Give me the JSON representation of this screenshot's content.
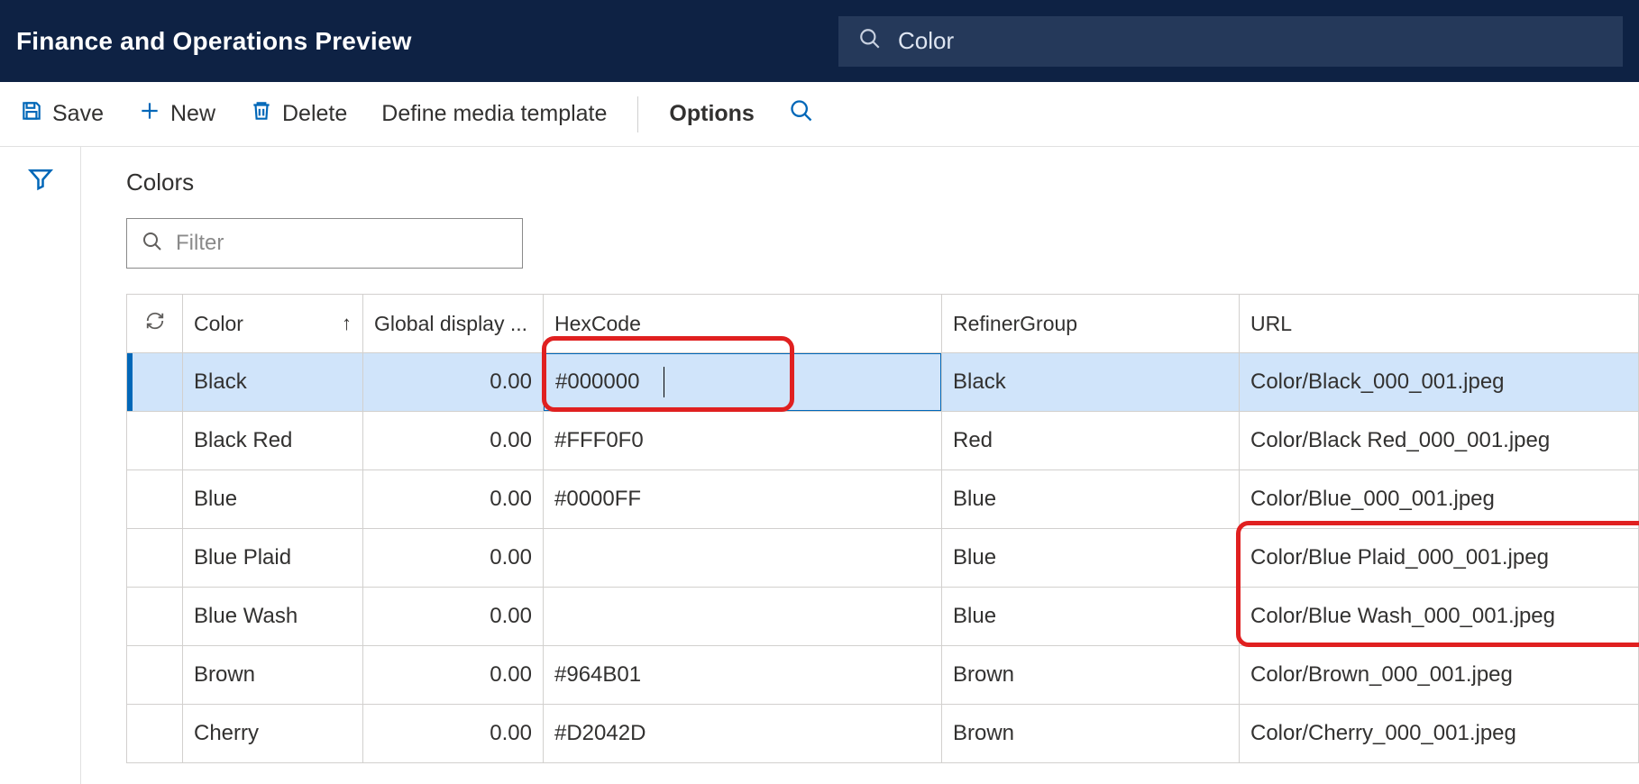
{
  "header": {
    "title": "Finance and Operations Preview",
    "search_value": "Color"
  },
  "toolbar": {
    "save": "Save",
    "new": "New",
    "delete": "Delete",
    "define_media": "Define media template",
    "options": "Options"
  },
  "page": {
    "title": "Colors",
    "filter_placeholder": "Filter"
  },
  "grid": {
    "headers": {
      "color": "Color",
      "global": "Global display ...",
      "hex": "HexCode",
      "refiner": "RefinerGroup",
      "url": "URL"
    },
    "rows": [
      {
        "color": "Black",
        "global": "0.00",
        "hex": "#000000",
        "refiner": "Black",
        "url": "Color/Black_000_001.jpeg",
        "selected": true
      },
      {
        "color": "Black Red",
        "global": "0.00",
        "hex": "#FFF0F0",
        "refiner": "Red",
        "url": "Color/Black Red_000_001.jpeg"
      },
      {
        "color": "Blue",
        "global": "0.00",
        "hex": "#0000FF",
        "refiner": "Blue",
        "url": "Color/Blue_000_001.jpeg"
      },
      {
        "color": "Blue Plaid",
        "global": "0.00",
        "hex": "",
        "refiner": "Blue",
        "url": "Color/Blue Plaid_000_001.jpeg"
      },
      {
        "color": "Blue Wash",
        "global": "0.00",
        "hex": "",
        "refiner": "Blue",
        "url": "Color/Blue Wash_000_001.jpeg"
      },
      {
        "color": "Brown",
        "global": "0.00",
        "hex": "#964B01",
        "refiner": "Brown",
        "url": "Color/Brown_000_001.jpeg"
      },
      {
        "color": "Cherry",
        "global": "0.00",
        "hex": "#D2042D",
        "refiner": "Brown",
        "url": "Color/Cherry_000_001.jpeg"
      }
    ]
  }
}
